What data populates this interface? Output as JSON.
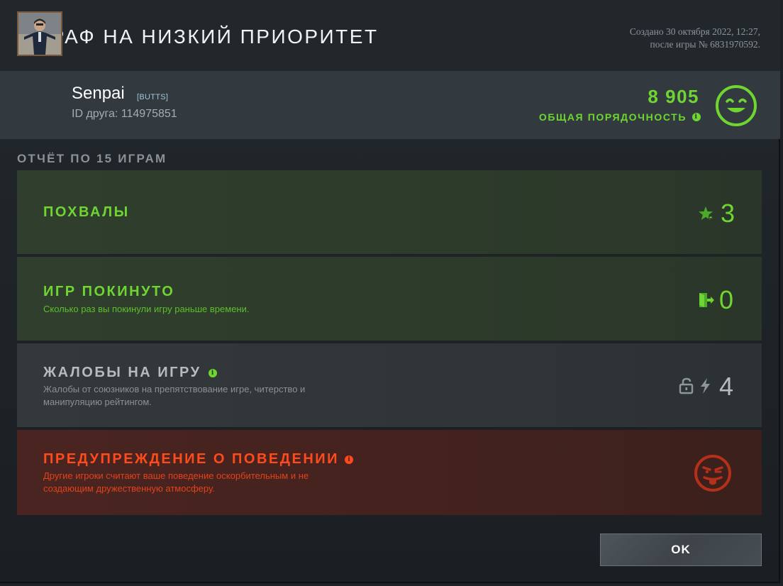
{
  "header": {
    "title": "ШТРАФ НА НИЗКИЙ ПРИОРИТЕТ",
    "created_line1": "Создано 30 октября 2022, 12:27,",
    "created_line2": "после игры № 6831970592."
  },
  "profile": {
    "username": "Senpai",
    "tag": "[BUTTS]",
    "friend_id": "ID друга: 114975851",
    "score": "8 905",
    "score_label": "ОБЩАЯ ПОРЯДОЧНОСТЬ",
    "info_glyph": "i"
  },
  "report": {
    "heading": "ОТЧЁТ ПО 15 ИГРАМ",
    "rows": [
      {
        "title": "ПОХВАЛЫ",
        "description": "",
        "value": "3",
        "icon": "star-commend-icon"
      },
      {
        "title": "ИГР ПОКИНУТО",
        "description": "Сколько раз вы покинули игру раньше времени.",
        "value": "0",
        "icon": "exit-door-icon"
      },
      {
        "title": "ЖАЛОБЫ НА ИГРУ",
        "description_line1": "Жалобы от союзников на препятствование игре, читерство и",
        "description_line2": "манипуляцию рейтингом.",
        "value": "4",
        "icon": "lightning-report-icon"
      },
      {
        "title": "ПРЕДУПРЕЖДЕНИЕ О ПОВЕДЕНИИ",
        "description_line1": "Другие игроки считают ваше поведение оскорбительным и не",
        "description_line2": "создающим дружественную атмосферу.",
        "icon": "tongue-face-icon"
      }
    ]
  },
  "buttons": {
    "ok": "OK"
  },
  "colors": {
    "good_green": "#6fd631",
    "warning_red": "#ff4a1c",
    "neutral_gray": "#b5bbbf"
  }
}
